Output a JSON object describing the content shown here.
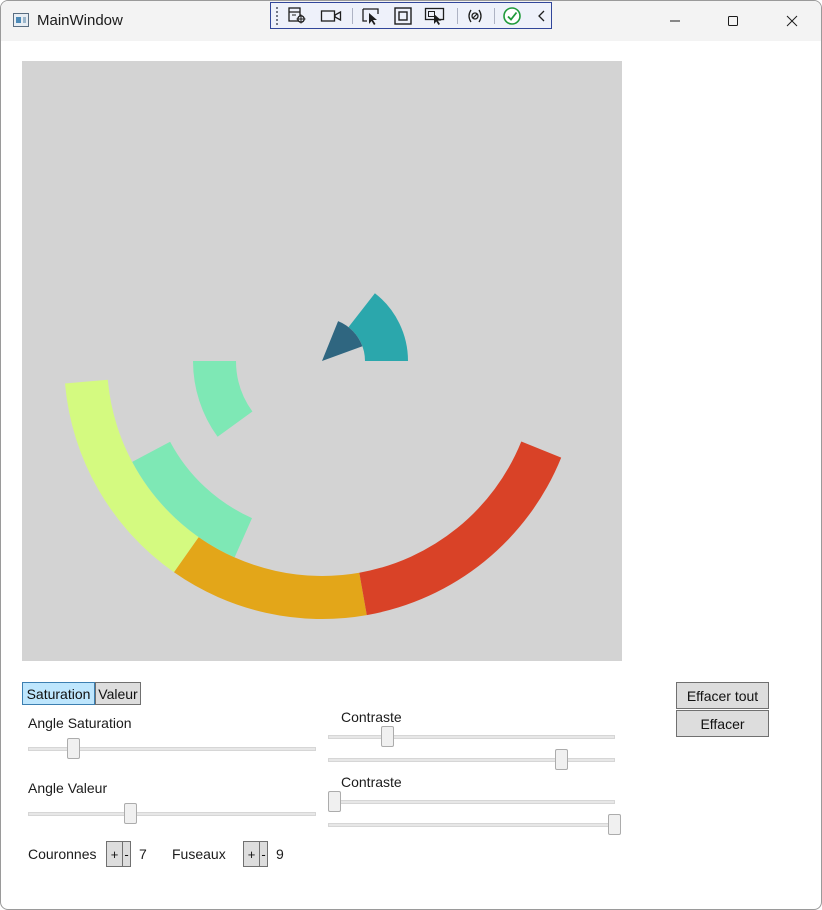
{
  "window": {
    "title": "MainWindow"
  },
  "icons": {
    "app": "app-window-icon",
    "devtools": [
      "live-visual-tree-icon",
      "record-icon",
      "select-element-icon",
      "display-layout-adorners-icon",
      "track-focus-icon",
      "hot-reload-icon",
      "hot-reload-status-icon",
      "collapse-toolbar-icon"
    ],
    "window_controls": [
      "minimize-icon",
      "maximize-icon",
      "close-icon"
    ]
  },
  "colors": {
    "canvas_background": "#d3d3d3",
    "active_tab": "#bee6fd",
    "segments": [
      "#e3a619",
      "#d94227",
      "#d4fa80",
      "#7ee8b5",
      "#2ba7ac",
      "#2f6680"
    ]
  },
  "tabs": [
    {
      "label": "Saturation",
      "active": true
    },
    {
      "label": "Valeur",
      "active": false
    }
  ],
  "controls": {
    "angle_saturation": {
      "label": "Angle Saturation",
      "level": 0.14
    },
    "angle_valeur": {
      "label": "Angle Valeur",
      "level": 0.34
    },
    "contraste_1": {
      "label": "Contraste",
      "levels": [
        0.19,
        0.81
      ]
    },
    "contraste_2": {
      "label": "Contraste",
      "levels": [
        0.0,
        1.0
      ]
    },
    "couronnes": {
      "label": "Couronnes",
      "plus": "+",
      "minus": "-",
      "value": "7"
    },
    "fuseaux": {
      "label": "Fuseaux",
      "plus": "+",
      "minus": "-",
      "value": "9"
    }
  },
  "actions": {
    "clear_all": "Effacer tout",
    "clear": "Effacer"
  }
}
